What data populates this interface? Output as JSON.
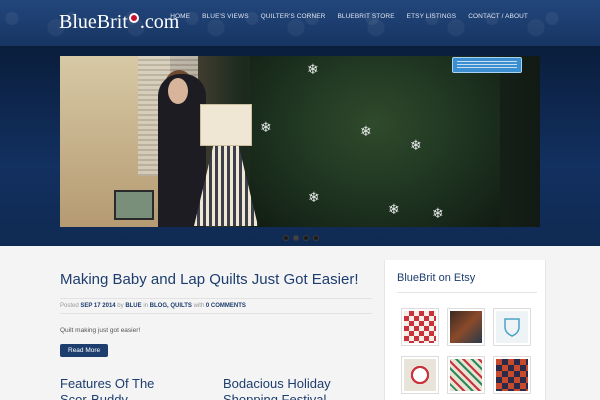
{
  "header": {
    "logo_text_1": "BlueBrit",
    "logo_text_2": ".com",
    "nav": [
      "HOME",
      "BLUE'S VIEWS",
      "QUILTER'S CORNER",
      "BLUEBRIT STORE",
      "ETSY LISTINGS",
      "CONTACT / ABOUT"
    ]
  },
  "slider": {
    "dots": 4,
    "active_dot": 1
  },
  "post": {
    "title": "Making Baby and Lap Quilts Just Got Easier!",
    "meta_posted": "Posted",
    "meta_date": "SEP 17 2014",
    "meta_by": "by",
    "meta_author": "BLUE",
    "meta_in": "in",
    "meta_categories": "BLOG, QUILTS",
    "meta_with": "with",
    "meta_comments": "0 COMMENTS",
    "excerpt": "Quilt making just got easier!",
    "read_more": "Read More"
  },
  "teasers": [
    {
      "title_line1": "Features Of The",
      "title_line2": "Scor-Buddy"
    },
    {
      "title_line1": "Bodacious Holiday",
      "title_line2": "Shopping Festival"
    }
  ],
  "sidebar": {
    "widget_title": "BlueBrit on Etsy",
    "thumb_icons": [
      "quilt-grid",
      "quilt-dark",
      "shield-pillow",
      "quilt-sampler",
      "quilt-colorful",
      "quilt-dark-squares"
    ],
    "colors": {
      "brand_blue": "#1d3d6e"
    }
  }
}
